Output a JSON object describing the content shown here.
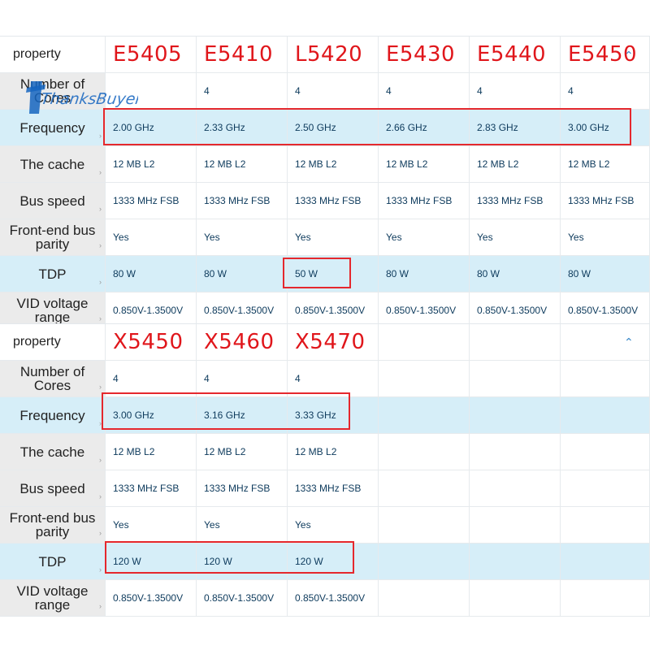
{
  "table1": {
    "property_label": "property",
    "models": [
      "E5405",
      "E5410",
      "L5420",
      "E5430",
      "E5440",
      "E5450"
    ],
    "rows": [
      {
        "label": "Number of Cores",
        "values": [
          "",
          "4",
          "4",
          "4",
          "4",
          "4"
        ]
      },
      {
        "label": "Frequency",
        "values": [
          "2.00 GHz",
          "2.33 GHz",
          "2.50 GHz",
          "2.66 GHz",
          "2.83 GHz",
          "3.00 GHz"
        ]
      },
      {
        "label": "The cache",
        "values": [
          "12 MB L2",
          "12 MB L2",
          "12 MB L2",
          "12 MB L2",
          "12 MB L2",
          "12 MB L2"
        ]
      },
      {
        "label": "Bus speed",
        "values": [
          "1333 MHz FSB",
          "1333 MHz FSB",
          "1333 MHz FSB",
          "1333 MHz FSB",
          "1333 MHz FSB",
          "1333 MHz FSB"
        ]
      },
      {
        "label": "Front-end bus parity",
        "values": [
          "Yes",
          "Yes",
          "Yes",
          "Yes",
          "Yes",
          "Yes"
        ]
      },
      {
        "label": "TDP",
        "values": [
          "80 W",
          "80 W",
          "50 W",
          "80 W",
          "80 W",
          "80 W"
        ]
      },
      {
        "label": "VID voltage range",
        "values": [
          "0.850V-1.3500V",
          "0.850V-1.3500V",
          "0.850V-1.3500V",
          "0.850V-1.3500V",
          "0.850V-1.3500V",
          "0.850V-1.3500V"
        ]
      }
    ]
  },
  "table2": {
    "property_label": "property",
    "models": [
      "X5450",
      "X5460",
      "X5470",
      "",
      "",
      ""
    ],
    "rows": [
      {
        "label": "Number of Cores",
        "values": [
          "4",
          "4",
          "4",
          "",
          "",
          ""
        ]
      },
      {
        "label": "Frequency",
        "values": [
          "3.00 GHz",
          "3.16 GHz",
          "3.33 GHz",
          "",
          "",
          ""
        ]
      },
      {
        "label": "The cache",
        "values": [
          "12 MB L2",
          "12 MB L2",
          "12 MB L2",
          "",
          "",
          ""
        ]
      },
      {
        "label": "Bus speed",
        "values": [
          "1333 MHz FSB",
          "1333 MHz FSB",
          "1333 MHz FSB",
          "",
          "",
          ""
        ]
      },
      {
        "label": "Front-end bus parity",
        "values": [
          "Yes",
          "Yes",
          "Yes",
          "",
          "",
          ""
        ]
      },
      {
        "label": "TDP",
        "values": [
          "120 W",
          "120 W",
          "120 W",
          "",
          "",
          ""
        ]
      },
      {
        "label": "VID voltage range",
        "values": [
          "0.850V-1.3500V",
          "0.850V-1.3500V",
          "0.850V-1.3500V",
          "",
          "",
          ""
        ]
      }
    ]
  },
  "icons": {
    "collapse": "chevron-up-icon",
    "row_expand": "chevron-right-icon"
  },
  "watermark_text": "ThanksBuyer",
  "colors": {
    "model_red": "#e0161b",
    "highlight_blue": "#d6eef8",
    "label_gray": "#ebebeb",
    "value_text": "#0d3a5c",
    "box_red": "#e5282d",
    "watermark_blue": "#1565c0"
  }
}
